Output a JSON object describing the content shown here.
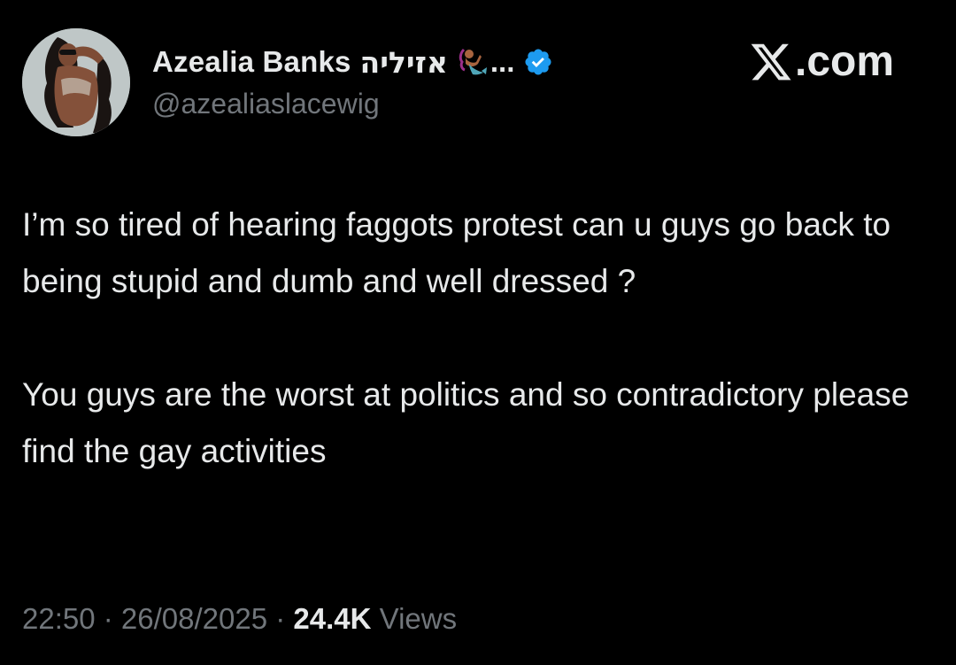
{
  "author": {
    "display_name": "Azealia Banks",
    "hebrew_name": "אזיליה",
    "ellipsis": "...",
    "handle": "@azealiaslacewig",
    "verified": true,
    "verified_color": "#1d9bf0",
    "emoji_icon": "mermaid-emoji"
  },
  "source": {
    "label": ".com"
  },
  "tweet": {
    "paragraphs": [
      "I’m so tired of hearing faggots protest can u guys go back to being stupid and dumb and well dressed ?",
      "You guys are the worst at politics and so contradictory please find the gay activities"
    ]
  },
  "meta": {
    "time": "22:50",
    "separator_1": " · ",
    "date": "26/08/2025",
    "separator_2": " · ",
    "views_count": "24.4K",
    "views_label": " Views"
  },
  "colors": {
    "background": "#000000",
    "primary_text": "#e7e9ea",
    "secondary_text": "#71767b"
  }
}
